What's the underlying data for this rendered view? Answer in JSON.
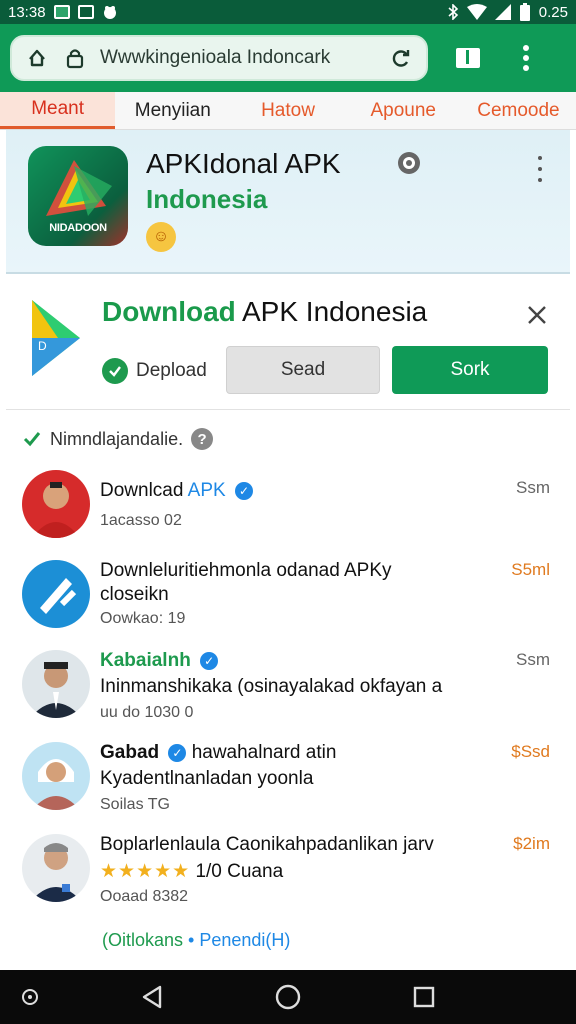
{
  "status_bar": {
    "time": "13:38",
    "battery": "0.25",
    "icons": [
      "notification-icon",
      "app-icon",
      "bluetooth-icon",
      "wifi-icon",
      "signal-icon",
      "battery-icon"
    ]
  },
  "browser": {
    "url": "Wwwkingenioala Indoncark",
    "icons": [
      "home-icon",
      "lock-icon",
      "refresh-icon",
      "bookmark-icon",
      "more-vert-icon"
    ]
  },
  "tabs": [
    {
      "label": "Meant",
      "active": true
    },
    {
      "label": "Menyiian",
      "active": false
    },
    {
      "label": "Hatow",
      "active": false
    },
    {
      "label": "Apoune",
      "active": false
    },
    {
      "label": "Cemoode",
      "active": false
    }
  ],
  "app_card": {
    "title": "APKIdonal APK",
    "subtitle": "Indonesia",
    "icon_label": "NIDADOON"
  },
  "promo": {
    "title_green": "Download",
    "title_rest": "APK Indonesia",
    "status": "Depload",
    "button_secondary": "Sead",
    "button_primary": "Sork"
  },
  "list": {
    "header": "Nimndlajandalie.",
    "items": [
      {
        "title": "Downlcad",
        "title_suffix": "APK",
        "line2": "",
        "meta": "1acasso 02",
        "size": "Ssm",
        "size_color": "gray"
      },
      {
        "title": "Downleluritiehmonla odanad APKy",
        "line2": "closeikn",
        "meta": "Oowkao: 19",
        "size": "S5ml",
        "size_color": "orange"
      },
      {
        "title": "Kabaialnh",
        "line2": "Ininmanshikaka (osinayalakad okfayan a",
        "meta": "uu do 1030 0",
        "size": "Ssm",
        "size_color": "gray"
      },
      {
        "title": "Gabad",
        "title_suffix": "hawahalnard atin",
        "line2": "Kyadentlnanladan yoonla",
        "meta": "Soilas TG",
        "size": "$Ssd",
        "size_color": "orange"
      },
      {
        "title": "Boplarlenlaula Caonikahpadanlikan jarv",
        "rating_text": "1/0 Cuana",
        "meta": "Ooaad 8382",
        "size": "$2im",
        "size_color": "orange"
      }
    ],
    "footer_left": "(Oitlokans",
    "footer_sep": "•",
    "footer_right": "Penendi(H)"
  },
  "nav": [
    "back-icon",
    "home-circle-icon",
    "recents-icon"
  ]
}
